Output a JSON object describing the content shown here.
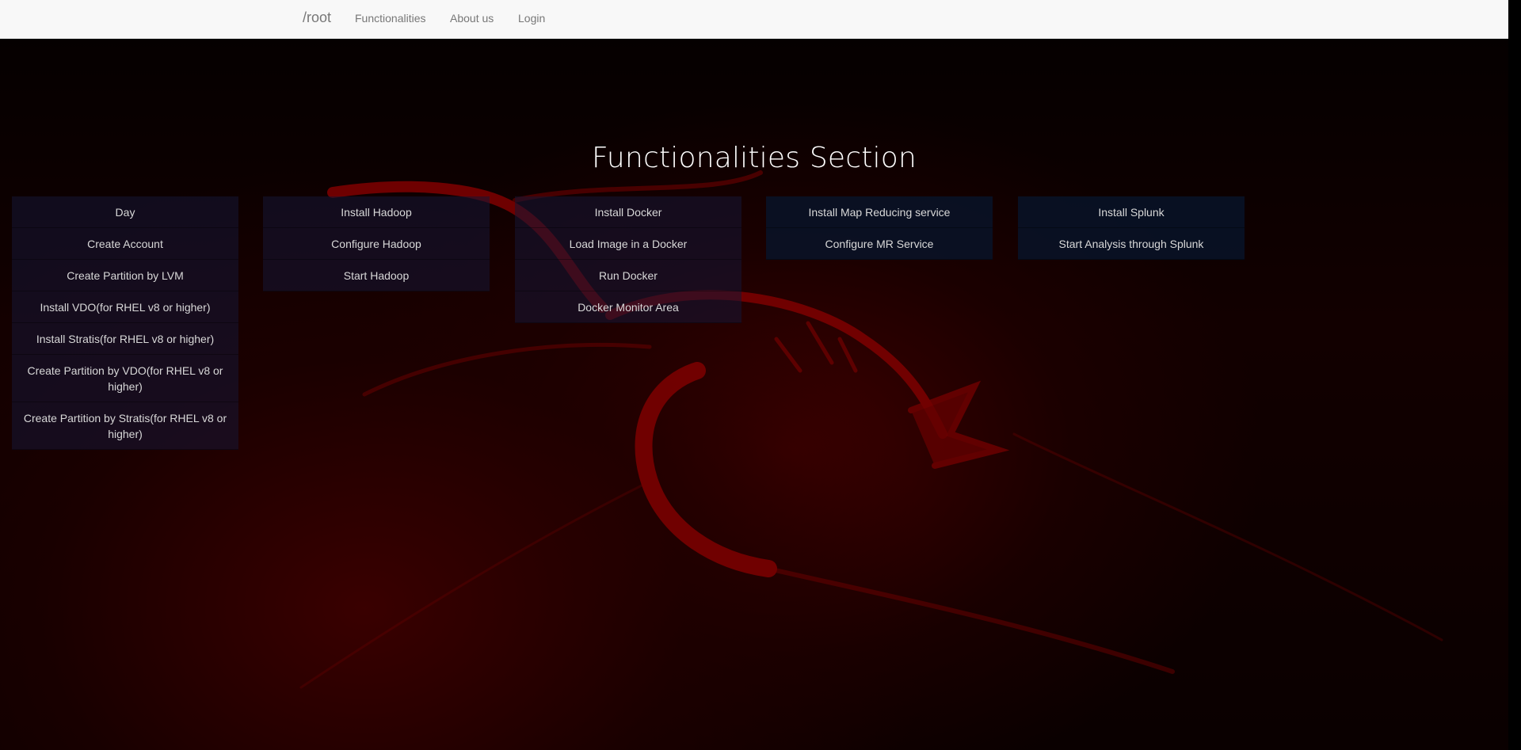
{
  "navbar": {
    "brand": "/root",
    "links": [
      "Functionalities",
      "About us",
      "Login"
    ]
  },
  "section_title": "Functionalities Section",
  "menus": [
    {
      "items": [
        "Day",
        "Create Account",
        "Create Partition by LVM",
        "Install VDO(for RHEL v8 or higher)",
        "Install Stratis(for RHEL v8 or higher)",
        "Create Partition by VDO(for RHEL v8 or higher)",
        "Create Partition by Stratis(for RHEL v8 or higher)"
      ]
    },
    {
      "items": [
        "Install Hadoop",
        "Configure Hadoop",
        "Start Hadoop"
      ]
    },
    {
      "items": [
        "Install Docker",
        "Load Image in a Docker",
        "Run Docker",
        "Docker Monitor Area"
      ]
    },
    {
      "items": [
        "Install Map Reducing service",
        "Configure MR Service"
      ]
    },
    {
      "items": [
        "Install Splunk",
        "Start Analysis through Splunk"
      ]
    }
  ],
  "colors": {
    "navbar_bg": "#f8f8f8",
    "nav_text": "#777777",
    "title_text": "#ffffff",
    "menu_text": "#d8d8d8",
    "accent_red": "#8b0000"
  }
}
